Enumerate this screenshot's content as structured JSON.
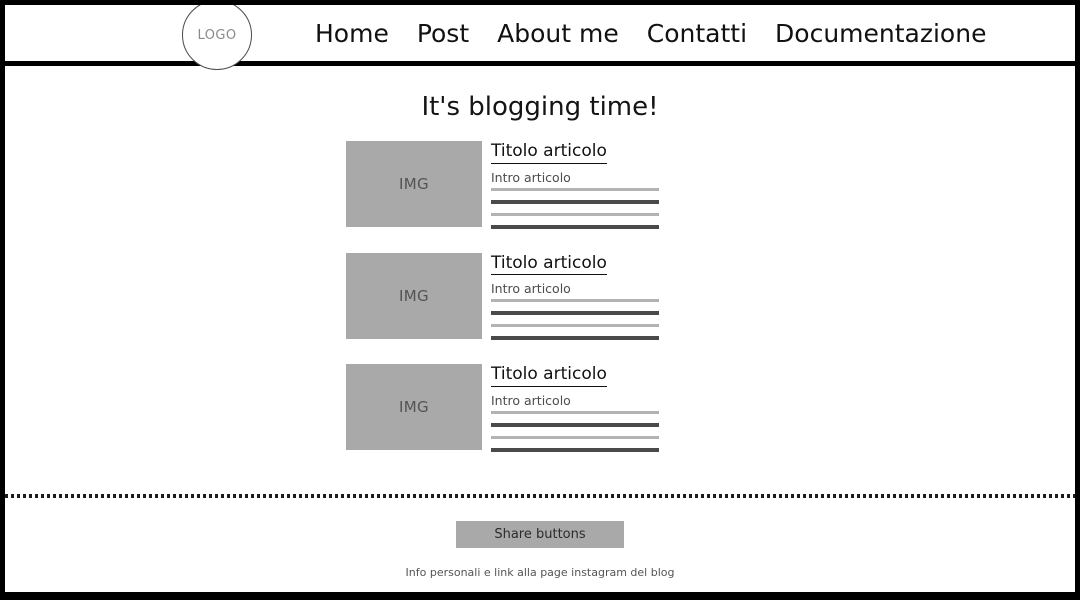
{
  "header": {
    "logo": {
      "icon": "circle-logo-placeholder",
      "label": "LOGO"
    },
    "nav": [
      {
        "label": "Home"
      },
      {
        "label": "Post"
      },
      {
        "label": "About me"
      },
      {
        "label": "Contatti"
      },
      {
        "label": "Documentazione"
      }
    ]
  },
  "main": {
    "title": "It's blogging time!",
    "articles": [
      {
        "image_label": "IMG",
        "title": "Titolo articolo",
        "intro": "Intro articolo",
        "body_lines": [
          "light",
          "dark",
          "light",
          "dark"
        ]
      },
      {
        "image_label": "IMG",
        "title": "Titolo articolo",
        "intro": "Intro articolo",
        "body_lines": [
          "light",
          "dark",
          "light",
          "dark"
        ]
      },
      {
        "image_label": "IMG",
        "title": "Titolo articolo",
        "intro": "Intro articolo",
        "body_lines": [
          "light",
          "dark",
          "light",
          "dark"
        ]
      }
    ]
  },
  "footer": {
    "share_button_label": "Share buttons",
    "info_text": "Info personali e link alla page instagram del blog"
  },
  "colors": {
    "border": "#000000",
    "placeholder_gray": "#a9a9a9",
    "line_light": "#b3b3b3",
    "line_dark": "#4a4a4a",
    "text_dark": "#111111",
    "text_muted": "#555555"
  }
}
